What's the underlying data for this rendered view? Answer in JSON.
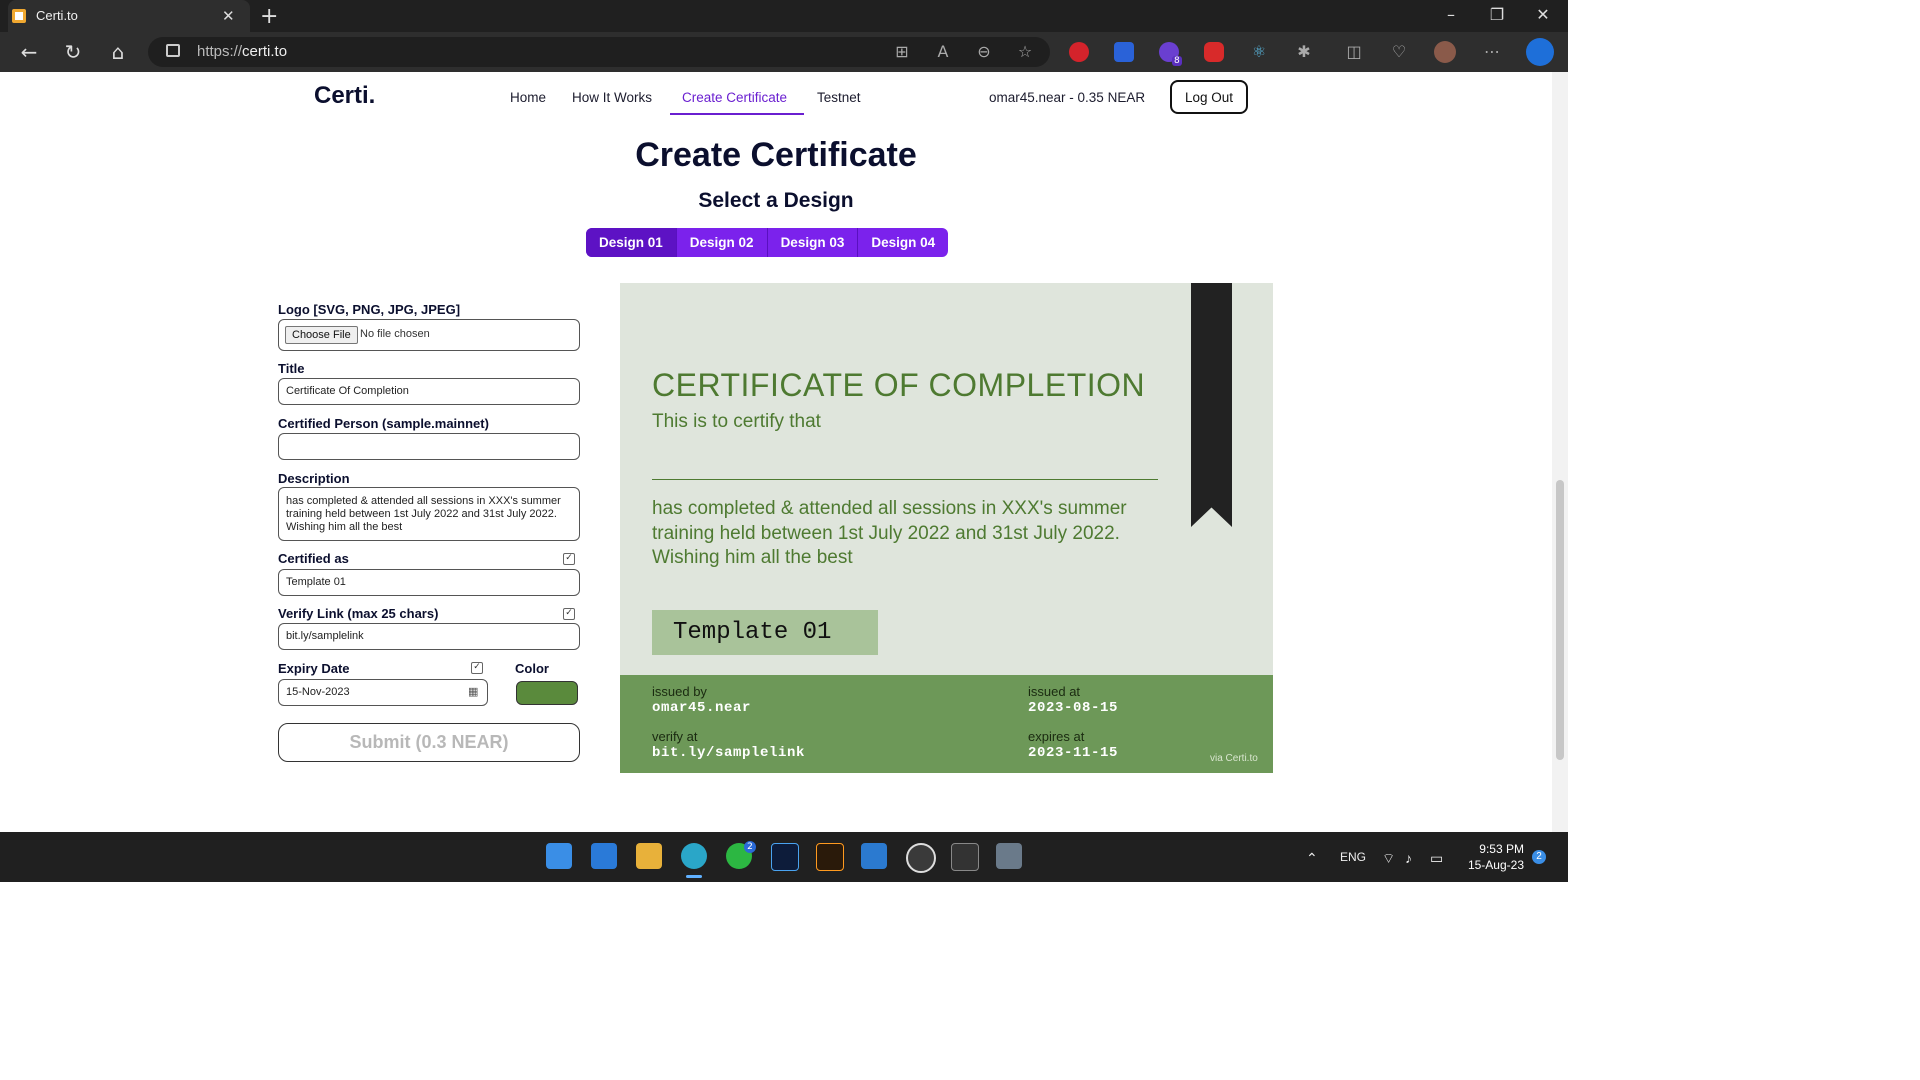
{
  "browser": {
    "tab_title": "Certi.to",
    "url": "https://certi.to",
    "url_scheme": "https://",
    "url_host": "certi.to",
    "ext_badge_count": "8"
  },
  "site": {
    "logo": "Certi.",
    "nav": [
      "Home",
      "How It Works",
      "Create Certificate",
      "Testnet"
    ],
    "active_nav": "Create Certificate",
    "account": "omar45.near - 0.35 NEAR",
    "logout_label": "Log Out"
  },
  "page": {
    "title": "Create Certificate",
    "subtitle": "Select a Design",
    "designs": [
      "Design 01",
      "Design 02",
      "Design 03",
      "Design 04"
    ],
    "selected_design": "Design 01"
  },
  "form": {
    "logo_label": "Logo [SVG, PNG, JPG, JPEG]",
    "choose_file_label": "Choose File",
    "file_status": "No file chosen",
    "title_label": "Title",
    "title_value": "Certificate Of Completion",
    "person_label": "Certified Person (sample.mainnet)",
    "person_value": "",
    "description_label": "Description",
    "description_value": "has completed & attended all sessions in XXX's summer training held between 1st July 2022 and 31st July 2022. Wishing him all the best",
    "certified_as_label": "Certified as",
    "certified_as_value": "Template 01",
    "verify_label": "Verify Link (max 25 chars)",
    "verify_value": "bit.ly/samplelink",
    "expiry_label": "Expiry Date",
    "expiry_value": "15-Nov-2023",
    "color_label": "Color",
    "color_value": "#5a8a3c",
    "submit_label": "Submit (0.3 NEAR)"
  },
  "certificate": {
    "title": "CERTIFICATE OF COMPLETION",
    "subtitle": "This is to certify that",
    "description": "has completed & attended all sessions in XXX's summer training held between 1st July 2022 and 31st July 2022. Wishing him all the best",
    "badge": "Template 01",
    "issued_by_label": "issued by",
    "issued_by": "omar45.near",
    "issued_at_label": "issued at",
    "issued_at": "2023-08-15",
    "verify_at_label": "verify at",
    "verify_at": "bit.ly/samplelink",
    "expires_at_label": "expires at",
    "expires_at": "2023-11-15",
    "via": "via Certi.to",
    "accent_color": "#4e7a31"
  },
  "taskbar": {
    "lang": "ENG",
    "time": "9:53 PM",
    "date": "15-Aug-23",
    "notification_count": "2",
    "whatsapp_badge": "2"
  }
}
